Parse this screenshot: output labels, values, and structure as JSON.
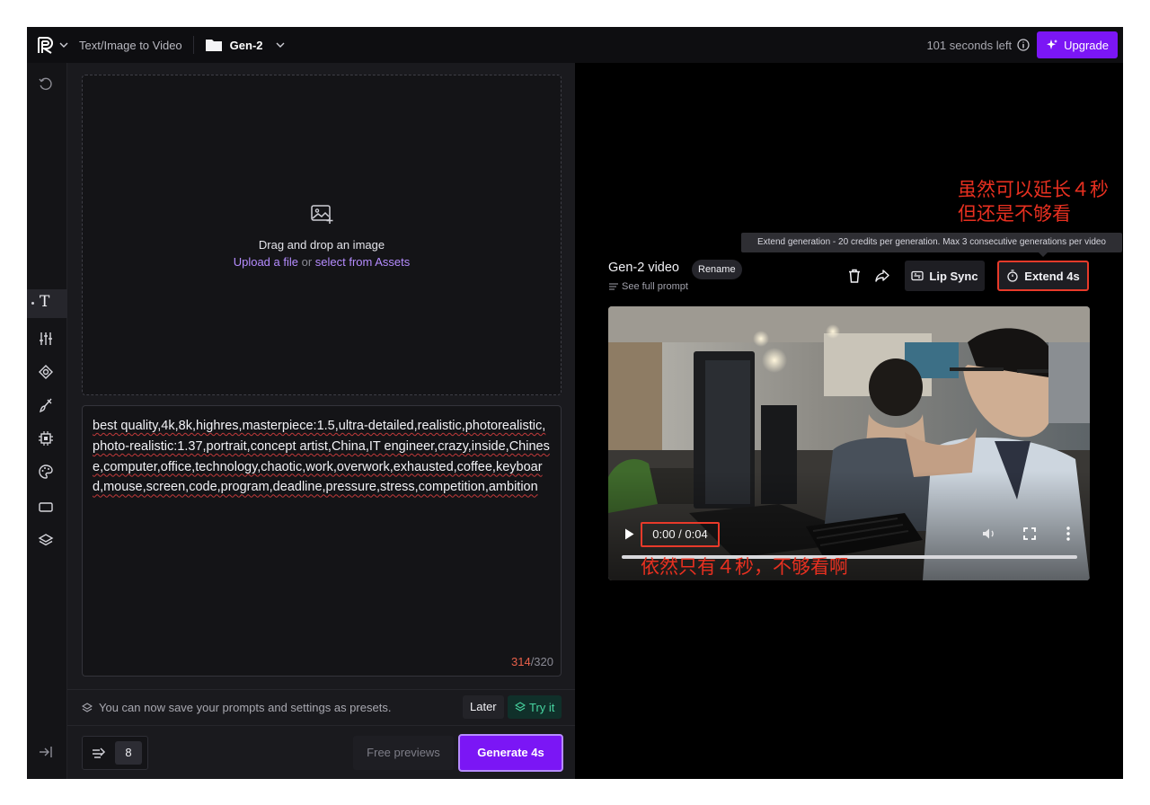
{
  "topbar": {
    "tool_title": "Text/Image to Video",
    "folder_name": "Gen-2",
    "seconds_left": "101 seconds left",
    "upgrade_label": "Upgrade",
    "accent_color": "#7b16f5"
  },
  "sidebar": {
    "active_item": "T",
    "icons": [
      "history-icon",
      "text-tool-icon",
      "settings-sliders-icon",
      "camera-motion-icon",
      "motion-brush-icon",
      "chip-icon",
      "palette-icon",
      "aspect-ratio-icon",
      "layers-icon",
      "collapse-sidebar-icon"
    ]
  },
  "dropzone": {
    "title": "Drag and drop an image",
    "upload_link": "Upload a file",
    "or": " or ",
    "assets_link": "select from Assets"
  },
  "prompt": {
    "text": "best quality,4k,8k,highres,masterpiece:1.5,ultra-detailed,realistic,photorealistic,photo-realistic:1.37,portrait,concept artist,China,IT engineer,crazy,inside,Chinese,computer,office,technology,chaotic,work,overwork,exhausted,coffee,keyboard,mouse,screen,code,program,deadline,pressure,stress,competition,ambition",
    "count_current": "314",
    "count_max": "/320"
  },
  "presets_bar": {
    "message": "You can now save your prompts and settings as presets.",
    "later_label": "Later",
    "try_label": "Try it"
  },
  "bottom_bar": {
    "runs_count": "8",
    "free_previews_label": "Free previews",
    "generate_label": "Generate 4s"
  },
  "video_panel": {
    "title": "Gen-2 video",
    "rename_label": "Rename",
    "see_prompt_label": "See full prompt",
    "lip_sync_label": "Lip Sync",
    "extend_label": "Extend 4s",
    "tooltip": "Extend generation - 20 credits per generation. Max 3 consecutive generations per video",
    "time_display": "0:00 / 0:04",
    "progress": 0
  },
  "annotations": {
    "top_note": "虽然可以延长４秒\n但还是不够看",
    "bottom_note": "依然只有４秒，不够看啊",
    "color": "#e83020"
  }
}
